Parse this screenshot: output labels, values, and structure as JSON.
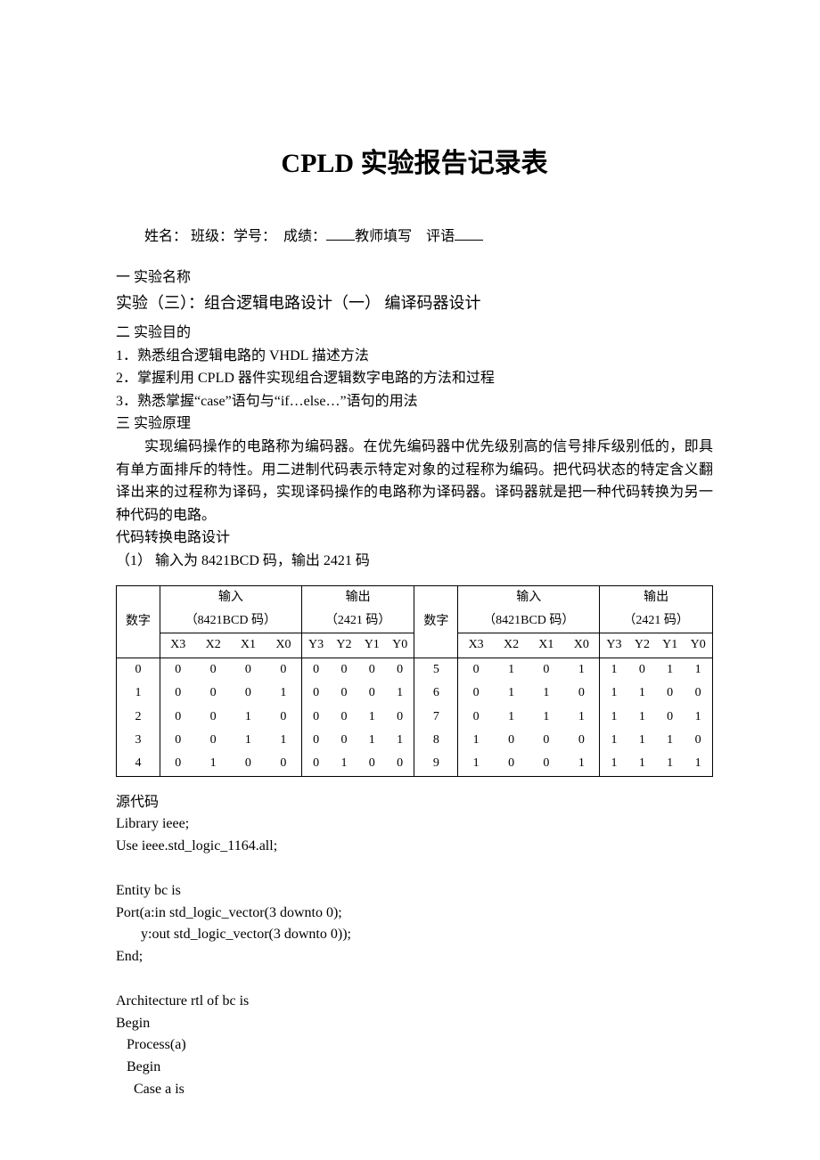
{
  "title": "CPLD 实验报告记录表",
  "info": {
    "name_label": "姓名：",
    "class_label": "班级：",
    "sid_label": "学号：",
    "grade_label": "成绩：",
    "teacher_label": "教师填写",
    "comment_label": "评语"
  },
  "sec1": {
    "heading": "一  实验名称",
    "body": "实验（三）：组合逻辑电路设计（一）    编译码器设计"
  },
  "sec2": {
    "heading": "二  实验目的",
    "items": [
      "1．熟悉组合逻辑电路的 VHDL 描述方法",
      "2．掌握利用 CPLD 器件实现组合逻辑数字电路的方法和过程",
      "3．熟悉掌握“case”语句与“if…else…”语句的用法"
    ]
  },
  "sec3": {
    "heading": "三  实验原理",
    "para": "实现编码操作的电路称为编码器。在优先编码器中优先级别高的信号排斥级别低的，即具有单方面排斥的特性。用二进制代码表示特定对象的过程称为编码。把代码状态的特定含义翻译出来的过程称为译码，实现译码操作的电路称为译码器。译码器就是把一种代码转换为另一种代码的电路。",
    "sub1": "代码转换电路设计",
    "sub2": "（1） 输入为 8421BCD 码，输出 2421 码"
  },
  "table": {
    "header": {
      "digit": "数字",
      "in_label": "输入",
      "in_sub": "（8421BCD 码）",
      "out_label": "输出",
      "out_sub": "（2421 码）",
      "cols1": [
        "X3",
        "X2",
        "X1",
        "X0",
        "Y3",
        "Y2",
        "Y1",
        "Y0"
      ],
      "cols2": [
        "X3",
        "X2",
        "X1",
        "X0",
        "Y3",
        "Y2",
        "Y1",
        "Y0"
      ]
    },
    "rows": [
      {
        "d1": "0",
        "l": [
          "0",
          "0",
          "0",
          "0",
          "0",
          "0",
          "0",
          "0"
        ],
        "d2": "5",
        "r": [
          "0",
          "1",
          "0",
          "1",
          "1",
          "0",
          "1",
          "1"
        ]
      },
      {
        "d1": "1",
        "l": [
          "0",
          "0",
          "0",
          "1",
          "0",
          "0",
          "0",
          "1"
        ],
        "d2": "6",
        "r": [
          "0",
          "1",
          "1",
          "0",
          "1",
          "1",
          "0",
          "0"
        ]
      },
      {
        "d1": "2",
        "l": [
          "0",
          "0",
          "1",
          "0",
          "0",
          "0",
          "1",
          "0"
        ],
        "d2": "7",
        "r": [
          "0",
          "1",
          "1",
          "1",
          "1",
          "1",
          "0",
          "1"
        ]
      },
      {
        "d1": "3",
        "l": [
          "0",
          "0",
          "1",
          "1",
          "0",
          "0",
          "1",
          "1"
        ],
        "d2": "8",
        "r": [
          "1",
          "0",
          "0",
          "0",
          "1",
          "1",
          "1",
          "0"
        ]
      },
      {
        "d1": "4",
        "l": [
          "0",
          "1",
          "0",
          "0",
          "0",
          "1",
          "0",
          "0"
        ],
        "d2": "9",
        "r": [
          "1",
          "0",
          "0",
          "1",
          "1",
          "1",
          "1",
          "1"
        ]
      }
    ]
  },
  "code": {
    "heading": "源代码",
    "lines": [
      "Library ieee;",
      "Use ieee.std_logic_1164.all;",
      "",
      "Entity bc is",
      "Port(a:in std_logic_vector(3 downto 0);",
      "       y:out std_logic_vector(3 downto 0));",
      "End;",
      "",
      "Architecture rtl of bc is",
      "Begin",
      "   Process(a)",
      "   Begin",
      "     Case a is"
    ]
  }
}
